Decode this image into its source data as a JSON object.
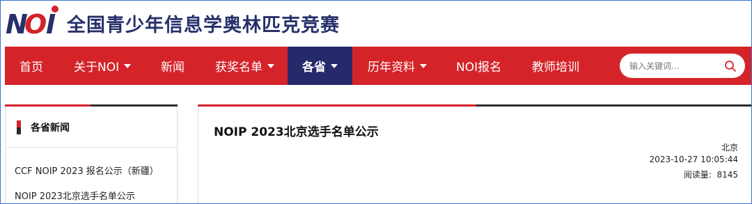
{
  "header": {
    "logo_text": "NOI",
    "site_title": "全国青少年信息学奥林匹克竞赛"
  },
  "nav": {
    "items": [
      {
        "label": "首页",
        "has_dropdown": false,
        "active": false
      },
      {
        "label": "关于NOI",
        "has_dropdown": true,
        "active": false
      },
      {
        "label": "新闻",
        "has_dropdown": false,
        "active": false
      },
      {
        "label": "获奖名单",
        "has_dropdown": true,
        "active": false
      },
      {
        "label": "各省",
        "has_dropdown": true,
        "active": true
      },
      {
        "label": "历年资料",
        "has_dropdown": true,
        "active": false
      },
      {
        "label": "NOI报名",
        "has_dropdown": false,
        "active": false
      },
      {
        "label": "教师培训",
        "has_dropdown": false,
        "active": false
      }
    ],
    "search": {
      "placeholder": "输入关键词...",
      "icon": "search-icon"
    }
  },
  "sidebar": {
    "title": "各省新闻",
    "links": [
      {
        "label": "CCF NOIP 2023 报名公示（新疆）"
      },
      {
        "label": "NOIP 2023北京选手名单公示"
      }
    ]
  },
  "article": {
    "title": "NOIP 2023北京选手名单公示",
    "province": "北京",
    "datetime": "2023-10-27 10:05:44",
    "views_label": "阅读量:",
    "views": "8145"
  },
  "colors": {
    "brand_red": "#d4242a",
    "brand_navy": "#262a6a",
    "title_navy": "#27306b"
  }
}
